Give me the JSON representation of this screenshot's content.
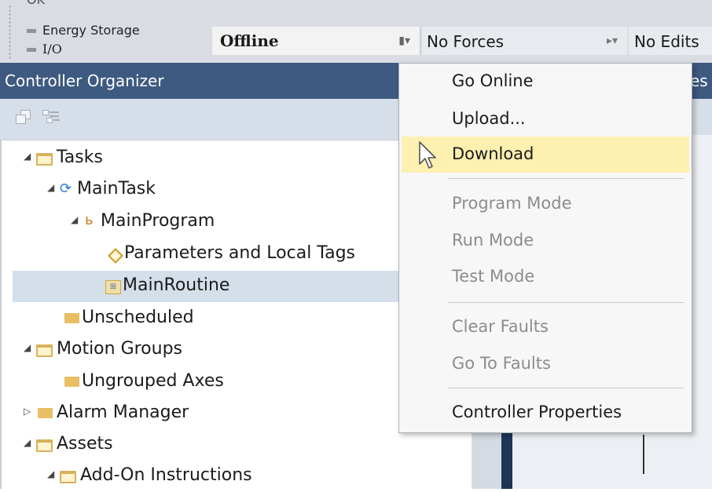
{
  "status": {
    "cut_off_text": "OK",
    "energy_storage": "Energy Storage",
    "io": "I/O"
  },
  "controller_bar": {
    "mode": "Offline",
    "forces": "No Forces",
    "edits": "No Edits"
  },
  "organizer": {
    "title": "Controller Organizer",
    "tree": [
      {
        "label": "Tasks",
        "icon": "folder-open-icon",
        "expanded": true
      },
      {
        "label": "MainTask",
        "icon": "task-icon",
        "expanded": true
      },
      {
        "label": "MainProgram",
        "icon": "program-icon",
        "expanded": true
      },
      {
        "label": "Parameters and Local Tags",
        "icon": "tag-icon"
      },
      {
        "label": "MainRoutine",
        "icon": "routine-icon",
        "selected": true
      },
      {
        "label": "Unscheduled",
        "icon": "folder-icon"
      },
      {
        "label": "Motion Groups",
        "icon": "folder-open-icon",
        "expanded": true
      },
      {
        "label": "Ungrouped Axes",
        "icon": "folder-icon"
      },
      {
        "label": "Alarm Manager",
        "icon": "folder-icon",
        "expanded": false
      },
      {
        "label": "Assets",
        "icon": "folder-open-icon",
        "expanded": true
      },
      {
        "label": "Add-On Instructions",
        "icon": "folder-open-icon",
        "expanded": true
      }
    ]
  },
  "editor": {
    "header_fragment": "es"
  },
  "menu": {
    "items": [
      {
        "label": "Go Online",
        "enabled": true
      },
      {
        "label": "Upload...",
        "enabled": true
      },
      {
        "label": "Download",
        "enabled": true,
        "highlighted": true
      },
      {
        "label": "Program Mode",
        "enabled": false
      },
      {
        "label": "Run Mode",
        "enabled": false
      },
      {
        "label": "Test Mode",
        "enabled": false
      },
      {
        "label": "Clear Faults",
        "enabled": false
      },
      {
        "label": "Go To Faults",
        "enabled": false
      },
      {
        "label": "Controller Properties",
        "enabled": true
      }
    ]
  },
  "colors": {
    "header_blue": "#3e5a80",
    "menu_highlight": "#fdf0b0",
    "selection": "#d4dfea"
  }
}
